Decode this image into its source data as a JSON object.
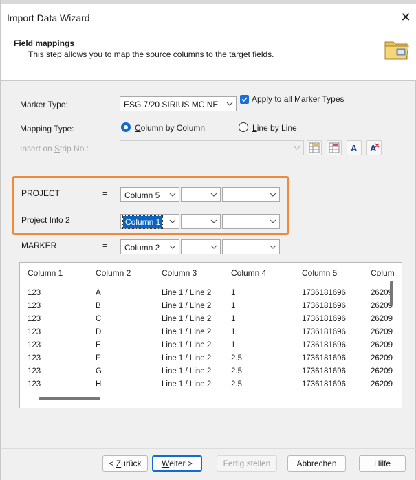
{
  "window": {
    "title": "Import Data Wizard",
    "close_glyph": "✕"
  },
  "header": {
    "title": "Field mappings",
    "subtitle": "This step allows you to map the source columns to the target fields.",
    "icon": "folder-icon"
  },
  "form": {
    "marker_type_label": "Marker Type:",
    "marker_type_value": "ESG 7/20 SIRIUS MC NE",
    "apply_all_label": "Apply to all Marker Types",
    "apply_all_checked": true,
    "mapping_type_label": "Mapping Type:",
    "mapping_col_by_col": {
      "prefix": "",
      "accel": "C",
      "rest": "olumn by Column"
    },
    "mapping_line_by_line": {
      "prefix": "",
      "accel": "L",
      "rest": "ine by Line"
    },
    "mapping_selected": "Column by Column",
    "insert_strip_label": {
      "prefix": "Insert on ",
      "accel": "S",
      "rest": "trip No.:"
    },
    "insert_strip_value": ""
  },
  "mappings": [
    {
      "field": "PROJECT",
      "eq": "=",
      "col1": "Column 5",
      "col2": "",
      "col3": ""
    },
    {
      "field": "Project Info 2",
      "eq": "=",
      "col1": "Column 1",
      "col2": "",
      "col3": ""
    },
    {
      "field": "MARKER",
      "eq": "=",
      "col1": "Column 2",
      "col2": "",
      "col3": ""
    }
  ],
  "grid": {
    "columns": [
      "Column 1",
      "Column 2",
      "Column 3",
      "Column 4",
      "Column 5",
      "Colum"
    ],
    "rows": [
      [
        "123",
        "A",
        "Line 1 / Line 2",
        "1",
        "1736181696",
        "26209"
      ],
      [
        "123",
        "B",
        "Line 1 / Line 2",
        "1",
        "1736181696",
        "26209"
      ],
      [
        "123",
        "C",
        "Line 1 / Line 2",
        "1",
        "1736181696",
        "26209"
      ],
      [
        "123",
        "D",
        "Line 1 / Line 2",
        "1",
        "1736181696",
        "26209"
      ],
      [
        "123",
        "E",
        "Line 1 / Line 2",
        "1",
        "1736181696",
        "26209"
      ],
      [
        "123",
        "F",
        "Line 1 / Line 2",
        "2.5",
        "1736181696",
        "26209"
      ],
      [
        "123",
        "G",
        "Line 1 / Line 2",
        "2.5",
        "1736181696",
        "26209"
      ],
      [
        "123",
        "H",
        "Line 1 / Line 2",
        "2.5",
        "1736181696",
        "26209"
      ]
    ]
  },
  "buttons": {
    "back": {
      "prefix": "< ",
      "accel": "Z",
      "rest": "urück"
    },
    "next": {
      "prefix": "",
      "accel": "W",
      "rest": "eiter >"
    },
    "finish": "Fertig stellen",
    "cancel": "Abbrechen",
    "help": "Hilfe"
  },
  "colors": {
    "accent": "#0f6cd1",
    "highlight_border": "#ef8a3b"
  }
}
